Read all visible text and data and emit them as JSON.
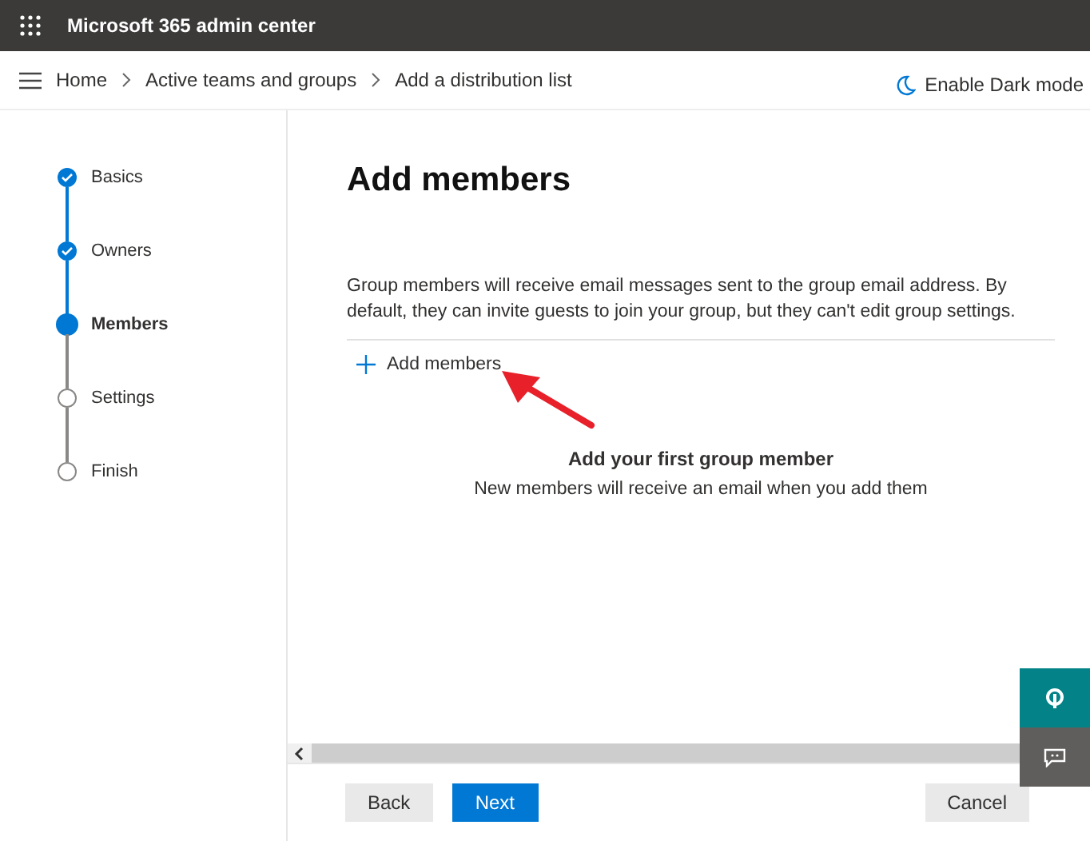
{
  "app_bar": {
    "title": "Microsoft 365 admin center"
  },
  "breadcrumb": [
    "Home",
    "Active teams and groups",
    "Add a distribution list"
  ],
  "dark_mode": {
    "label": "Enable Dark mode"
  },
  "steps": [
    {
      "label": "Basics",
      "completed": true,
      "selected": false
    },
    {
      "label": "Owners",
      "completed": true,
      "selected": false
    },
    {
      "label": "Members",
      "completed": false,
      "selected": true
    },
    {
      "label": "Settings",
      "completed": false,
      "selected": false
    },
    {
      "label": "Finish",
      "completed": false,
      "selected": false
    }
  ],
  "page": {
    "heading": "Add members",
    "description": "Group members will receive email messages sent to the group email address. By default, they can invite guests to join your group, but they can't edit group settings.",
    "add_button": "Add members",
    "empty_title": "Add your first group member",
    "empty_text": "New members will receive an email when you add them"
  },
  "footer": {
    "buttons": [
      {
        "label": "Back",
        "kind": "secondary"
      },
      {
        "label": "Next",
        "kind": "primary"
      },
      {
        "label": "Cancel",
        "kind": "secondary"
      }
    ]
  }
}
